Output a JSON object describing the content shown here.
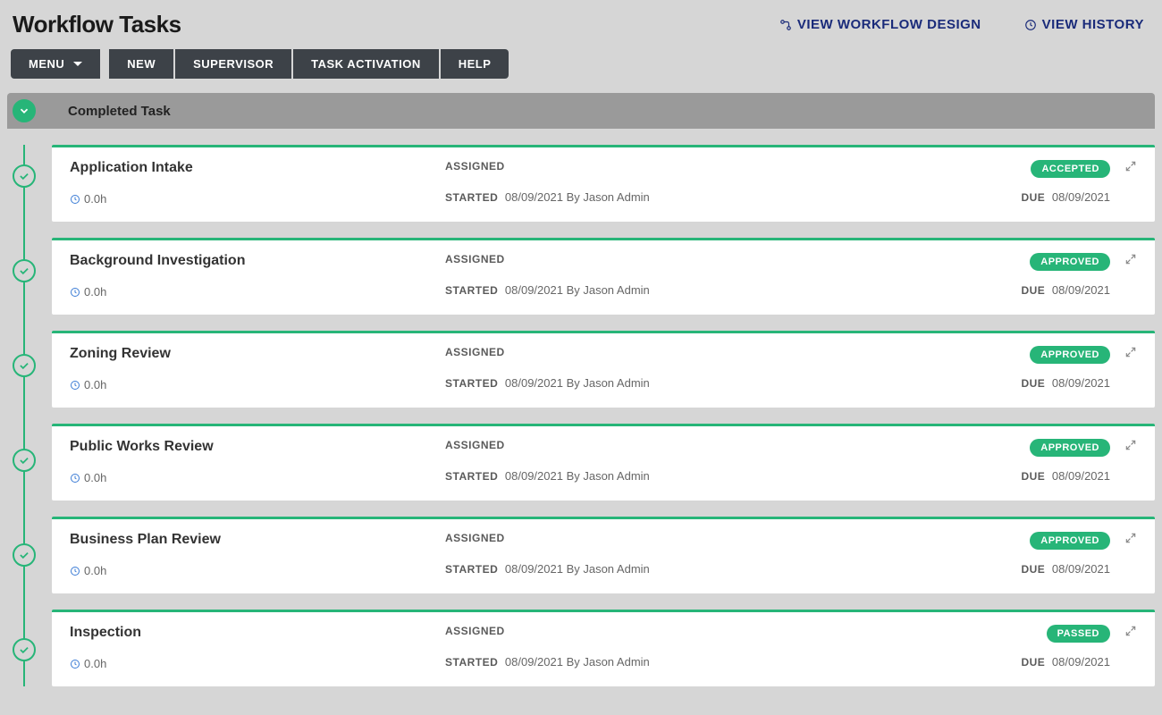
{
  "header": {
    "title": "Workflow Tasks",
    "links": {
      "design": "VIEW WORKFLOW DESIGN",
      "history": "VIEW HISTORY"
    }
  },
  "toolbar": {
    "menu": "MENU",
    "new": "NEW",
    "supervisor": "SUPERVISOR",
    "task_activation": "TASK ACTIVATION",
    "help": "HELP"
  },
  "section": {
    "title": "Completed Task"
  },
  "labels": {
    "assigned": "ASSIGNED",
    "started": "STARTED",
    "due": "DUE"
  },
  "tasks": [
    {
      "title": "Application Intake",
      "duration": "0.0h",
      "started_date": "08/09/2021",
      "started_by": "By Jason Admin",
      "due": "08/09/2021",
      "badge": "ACCEPTED"
    },
    {
      "title": "Background Investigation",
      "duration": "0.0h",
      "started_date": "08/09/2021",
      "started_by": "By Jason Admin",
      "due": "08/09/2021",
      "badge": "APPROVED"
    },
    {
      "title": "Zoning Review",
      "duration": "0.0h",
      "started_date": "08/09/2021",
      "started_by": "By Jason Admin",
      "due": "08/09/2021",
      "badge": "APPROVED"
    },
    {
      "title": "Public Works Review",
      "duration": "0.0h",
      "started_date": "08/09/2021",
      "started_by": "By Jason Admin",
      "due": "08/09/2021",
      "badge": "APPROVED"
    },
    {
      "title": "Business Plan Review",
      "duration": "0.0h",
      "started_date": "08/09/2021",
      "started_by": "By Jason Admin",
      "due": "08/09/2021",
      "badge": "APPROVED"
    },
    {
      "title": "Inspection",
      "duration": "0.0h",
      "started_date": "08/09/2021",
      "started_by": "By Jason Admin",
      "due": "08/09/2021",
      "badge": "PASSED"
    }
  ]
}
